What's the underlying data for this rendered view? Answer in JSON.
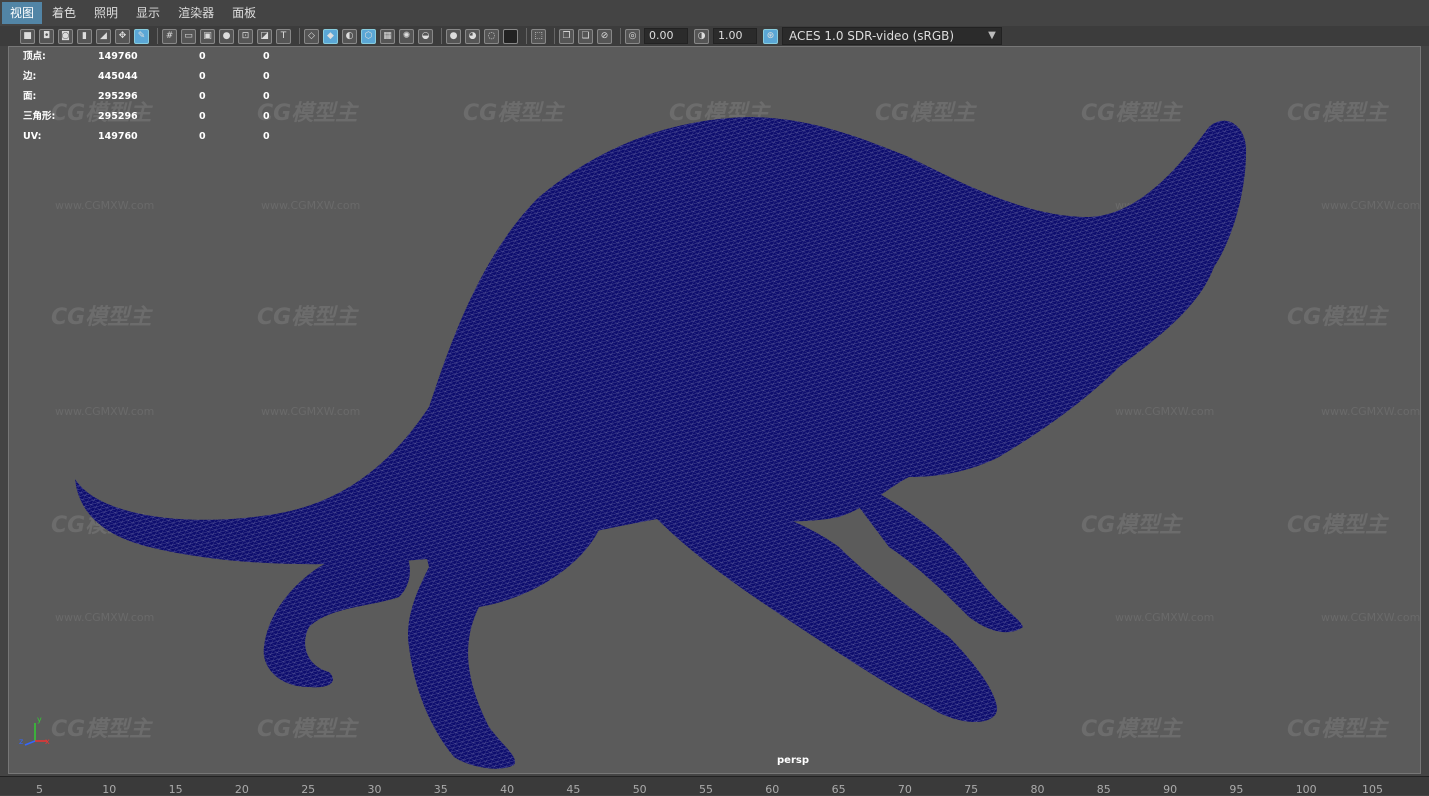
{
  "menu": [
    "视图",
    "着色",
    "照明",
    "显示",
    "渲染器",
    "面板"
  ],
  "toolbar": {
    "exposure": "0.00",
    "gamma": "1.00",
    "color_management": "ACES 1.0 SDR-video (sRGB)"
  },
  "hud": {
    "rows": [
      {
        "label": "顶点:",
        "v1": "149760",
        "v2": "0",
        "v3": "0"
      },
      {
        "label": "边:",
        "v1": "445044",
        "v2": "0",
        "v3": "0"
      },
      {
        "label": "面:",
        "v1": "295296",
        "v2": "0",
        "v3": "0"
      },
      {
        "label": "三角形:",
        "v1": "295296",
        "v2": "0",
        "v3": "0"
      },
      {
        "label": "UV:",
        "v1": "149760",
        "v2": "0",
        "v3": "0"
      }
    ]
  },
  "viewport": {
    "camera": "persp"
  },
  "watermark": {
    "logo": "CG模型主",
    "url": "www.CGMXW.com"
  },
  "axis": {
    "x": "x",
    "y": "y",
    "z": "z"
  },
  "ruler": [
    "5",
    "10",
    "15",
    "20",
    "25",
    "30",
    "35",
    "40",
    "45",
    "50",
    "55",
    "60",
    "65",
    "70",
    "75",
    "80",
    "85",
    "90",
    "95",
    "100",
    "105"
  ],
  "colors": {
    "mesh": "#0d0d6e",
    "viewport_bg": "#5b5b5b",
    "menu_active": "#5285a6"
  }
}
